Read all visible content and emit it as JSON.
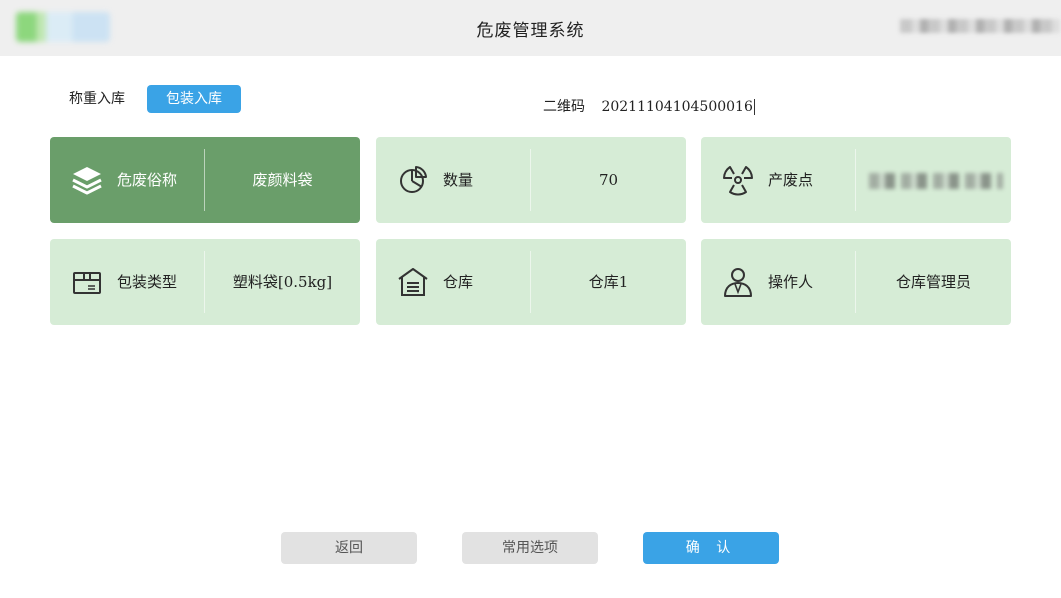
{
  "header": {
    "title": "危废管理系统"
  },
  "modes": [
    {
      "label": "称重入库",
      "active": false
    },
    {
      "label": "包装入库",
      "active": true
    }
  ],
  "qrcode": {
    "label": "二维码",
    "value": "20211104104500016"
  },
  "cards": [
    {
      "label": "危废俗称",
      "value": "废颜料袋",
      "icon": "layers-icon",
      "selected": true
    },
    {
      "label": "数量",
      "value": "70",
      "icon": "pie-chart-icon",
      "selected": false
    },
    {
      "label": "产废点",
      "value": "",
      "icon": "radiation-icon",
      "selected": false,
      "value_redacted": true
    },
    {
      "label": "包装类型",
      "value": "塑料袋[0.5kg]",
      "icon": "package-box-icon",
      "selected": false
    },
    {
      "label": "仓库",
      "value": "仓库1",
      "icon": "warehouse-icon",
      "selected": false
    },
    {
      "label": "操作人",
      "value": "仓库管理员",
      "icon": "user-icon",
      "selected": false
    }
  ],
  "buttons": {
    "back": "返回",
    "common_options": "常用选项",
    "confirm": "确 认"
  },
  "colors": {
    "accent_blue": "#3aa3e6",
    "card_green": "#d6ecd6",
    "card_selected_green": "#6a9e6a",
    "button_grey": "#e2e2e2"
  }
}
